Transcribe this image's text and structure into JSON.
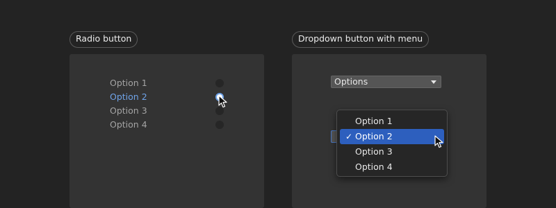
{
  "left_section": {
    "title": "Radio button",
    "options": [
      {
        "label": "Option 1",
        "selected": false
      },
      {
        "label": "Option 2",
        "selected": true
      },
      {
        "label": "Option 3",
        "selected": false
      },
      {
        "label": "Option 4",
        "selected": false
      }
    ]
  },
  "right_section": {
    "title": "Dropdown button with menu",
    "dropdown_value": "Options",
    "menu_items": [
      {
        "label": "Option 1",
        "checked": false
      },
      {
        "label": "Option 2",
        "checked": true
      },
      {
        "label": "Option 3",
        "checked": false
      },
      {
        "label": "Option 4",
        "checked": false
      }
    ],
    "check_glyph": "✓"
  },
  "colors": {
    "background": "#232323",
    "panel": "#333333",
    "accent": "#6fa3e8",
    "menu_highlight": "#2d5fbe"
  },
  "icons": [
    "radio-selected-icon",
    "mouse-pointer-icon",
    "caret-down-icon",
    "check-icon"
  ]
}
